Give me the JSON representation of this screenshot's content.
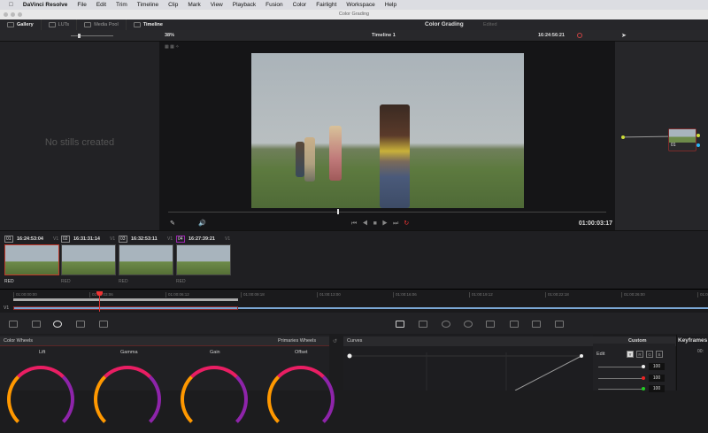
{
  "menubar": {
    "app": "DaVinci Resolve",
    "items": [
      "File",
      "Edit",
      "Trim",
      "Timeline",
      "Clip",
      "Mark",
      "View",
      "Playback",
      "Fusion",
      "Color",
      "Fairlight",
      "Workspace",
      "Help"
    ]
  },
  "window_title": "Color Grading",
  "topbar": {
    "gallery": "Gallery",
    "luts": "LUTs",
    "media_pool": "Media Pool",
    "timeline": "Timeline",
    "page_title": "Color Grading",
    "status": "Edited"
  },
  "viewer": {
    "zoom": "38%",
    "timeline_name": "Timeline 1",
    "source_tc": "16:24:56:21",
    "timecode": "01:00:03:17"
  },
  "gallery": {
    "empty": "No stills created"
  },
  "node": {
    "label": "01"
  },
  "clips": [
    {
      "num": "01",
      "tc": "16:24:53:04",
      "track": "V1",
      "label": "RED",
      "selected": true
    },
    {
      "num": "02",
      "tc": "16:31:31:14",
      "track": "V1",
      "label": "RED"
    },
    {
      "num": "03",
      "tc": "16:32:53:11",
      "track": "V1",
      "label": "RED"
    },
    {
      "num": "04",
      "tc": "16:27:39:21",
      "track": "V1",
      "label": "RED"
    }
  ],
  "ruler": {
    "track": "V1",
    "ticks": [
      "01:00:00:00",
      "01:00:03:06",
      "01:00:06:12",
      "01:00:09:18",
      "01:00:13:00",
      "01:00:16:06",
      "01:00:19:12",
      "01:00:22:18",
      "01:00:26:00",
      "01:0"
    ]
  },
  "color_wheels": {
    "title": "Color Wheels",
    "mode": "Primaries Wheels",
    "wheels": [
      "Lift",
      "Gamma",
      "Gain",
      "Offset"
    ]
  },
  "curves": {
    "title": "Curves",
    "mode": "Custom"
  },
  "edit": {
    "label": "Edit",
    "channels": [
      "Y",
      "R",
      "G",
      "B"
    ],
    "values": [
      "100",
      "100",
      "100"
    ]
  },
  "keyframes": {
    "title": "Keyframes",
    "tc": "00:"
  }
}
